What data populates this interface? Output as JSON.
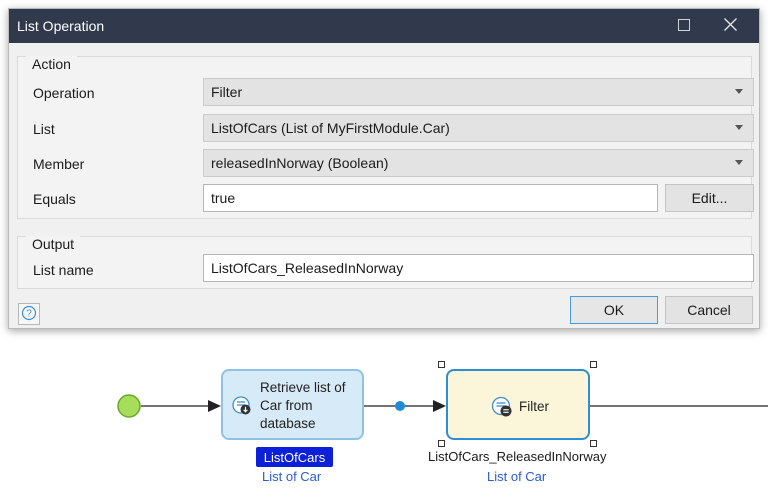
{
  "dialog": {
    "title": "List Operation",
    "action_group": {
      "legend": "Action",
      "operation_label": "Operation",
      "operation_value": "Filter",
      "list_label": "List",
      "list_value": "ListOfCars (List of MyFirstModule.Car)",
      "member_label": "Member",
      "member_value": "releasedInNorway (Boolean)",
      "equals_label": "Equals",
      "equals_value": "true",
      "edit_button": "Edit..."
    },
    "output_group": {
      "legend": "Output",
      "list_name_label": "List name",
      "list_name_value": "ListOfCars_ReleasedInNorway"
    },
    "ok_button": "OK",
    "cancel_button": "Cancel"
  },
  "microflow": {
    "retrieve_activity": {
      "line1": "Retrieve list of",
      "line2": "Car from",
      "line3": "database",
      "output_variable": "ListOfCars",
      "output_type": "List of Car"
    },
    "filter_activity": {
      "label": "Filter",
      "output_variable": "ListOfCars_ReleasedInNorway",
      "output_type": "List of Car"
    }
  },
  "colors": {
    "titlebar": "#303a4c",
    "start_event": "#a6dd5a",
    "flow_dot": "#1f8ad6",
    "variable_badge": "#0b20d8",
    "type_text": "#2a5bd0"
  },
  "icons": [
    "maximize-icon",
    "close-icon",
    "chevron-down-icon",
    "help-icon",
    "retrieve-icon",
    "filter-icon"
  ]
}
